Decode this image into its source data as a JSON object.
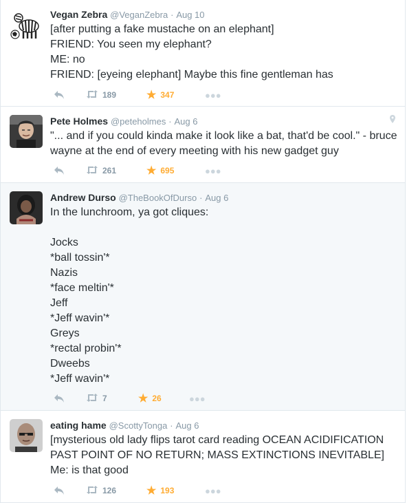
{
  "tweets": [
    {
      "fullname": "Vegan Zebra",
      "username": "@VeganZebra",
      "time": "Aug 10",
      "text": "[after putting a fake mustache on an elephant]\nFRIEND: You seen my elephant?\nME: no\nFRIEND: [eyeing elephant] Maybe this fine gentleman has",
      "retweets": "189",
      "favorites": "347",
      "avatar": "zebra-avatar"
    },
    {
      "fullname": "Pete Holmes",
      "username": "@peteholmes",
      "time": "Aug 6",
      "text": "\"... and if you could kinda make it look like a bat, that'd be cool.\" - bruce wayne at the end of every meeting with his new gadget guy",
      "retweets": "261",
      "favorites": "695",
      "avatar": "person-avatar",
      "has_geo": true
    },
    {
      "fullname": "Andrew Durso",
      "username": "@TheBookOfDurso",
      "time": "Aug 6",
      "text": "In the lunchroom, ya got cliques:\n\nJocks\n*ball tossin'*\nNazis\n*face meltin'*\nJeff\n*Jeff wavin'*\nGreys\n*rectal probin'*\nDweebs\n*Jeff wavin'*",
      "retweets": "7",
      "favorites": "26",
      "avatar": "person-avatar"
    },
    {
      "fullname": "eating hame",
      "username": "@ScottyTonga",
      "time": "Aug 6",
      "text": "[mysterious old lady flips tarot card reading OCEAN ACIDIFICATION PAST POINT OF NO RETURN; MASS EXTINCTIONS INEVITABLE]\nMe: is that good",
      "retweets": "126",
      "favorites": "193",
      "avatar": "person-avatar"
    }
  ],
  "separator": "·",
  "icons": {
    "reply": "reply-icon",
    "retweet": "retweet-icon",
    "favorite": "star-icon",
    "more": "more-icon",
    "geo": "location-pin-icon"
  },
  "colors": {
    "favorite_active": "#ffac33",
    "muted": "#8899a6",
    "icon_inactive": "#aab8c2",
    "alt_background": "#f5f8fa"
  }
}
